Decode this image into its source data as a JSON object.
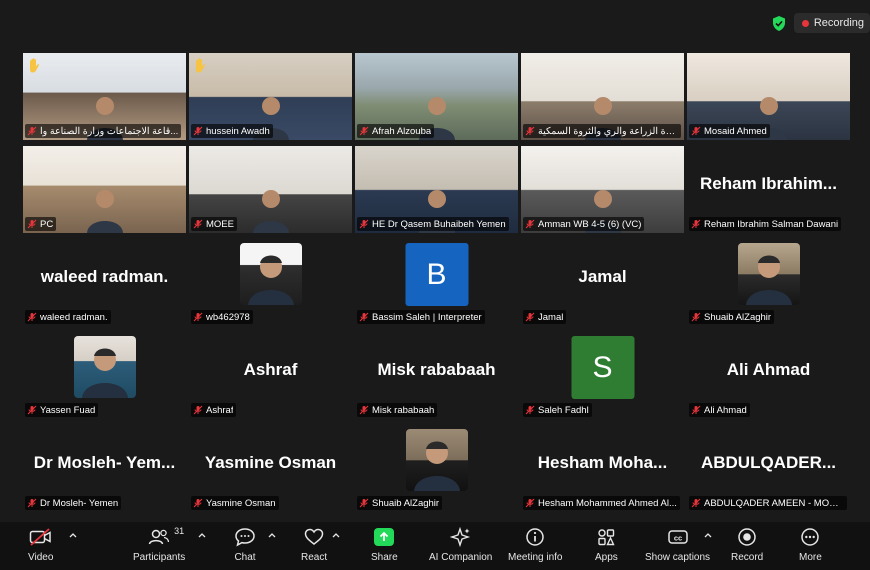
{
  "status": {
    "recording_label": "Recording",
    "secure_icon": "shield-check-icon",
    "recording_color": "#e8353b"
  },
  "colors": {
    "active_speaker": "#23d959",
    "share_button": "#23d959"
  },
  "tiles": [
    {
      "name": "قاعة الاجتماعات وزارة الصناعة وا...",
      "type": "video",
      "hand": true
    },
    {
      "name": "hussein Awadh",
      "type": "video",
      "hand": true
    },
    {
      "name": "Afrah Alzouba",
      "type": "video",
      "hand": false
    },
    {
      "name": "وزارة الزراعة والري والثروة السمكية",
      "type": "video",
      "hand": false
    },
    {
      "name": "Mosaid Ahmed",
      "type": "video",
      "hand": false
    },
    {
      "name": "PC",
      "type": "video",
      "hand": false
    },
    {
      "name": "MOEE",
      "type": "video",
      "hand": false,
      "active": true
    },
    {
      "name": "HE Dr Qasem Buhaibeh Yemen",
      "type": "video",
      "hand": false
    },
    {
      "name": "Amman WB 4-5 (6) (VC)",
      "type": "video",
      "hand": false
    },
    {
      "name": "Reham Ibrahim Salman Dawani",
      "type": "text",
      "display": "Reham Ibrahim..."
    },
    {
      "name": "waleed radman.",
      "type": "text",
      "display": "waleed radman."
    },
    {
      "name": "wb462978",
      "type": "photo"
    },
    {
      "name": "Bassim Saleh | Interpreter",
      "type": "letter",
      "letter": "B",
      "color": "#1565c0"
    },
    {
      "name": "Jamal",
      "type": "text",
      "display": "Jamal"
    },
    {
      "name": "Shuaib AlZaghir",
      "type": "photo"
    },
    {
      "name": "Yassen Fuad",
      "type": "photo"
    },
    {
      "name": "Ashraf",
      "type": "text",
      "display": "Ashraf"
    },
    {
      "name": "Misk rababaah",
      "type": "text",
      "display": "Misk rababaah"
    },
    {
      "name": "Saleh Fadhl",
      "type": "letter",
      "letter": "S",
      "color": "#2e7d32"
    },
    {
      "name": "Ali Ahmad",
      "type": "text",
      "display": "Ali Ahmad"
    },
    {
      "name": "Dr Mosleh- Yemen",
      "type": "text",
      "display": "Dr Mosleh- Yem..."
    },
    {
      "name": "Yasmine Osman",
      "type": "text",
      "display": "Yasmine Osman"
    },
    {
      "name": "Shuaib AlZaghir",
      "type": "photo"
    },
    {
      "name": "Hesham Mohammed Ahmed Al...",
      "type": "text",
      "display": "Hesham Moha..."
    },
    {
      "name": "ABDULQADER AMEEN - MOF-Y...",
      "type": "text",
      "display": "ABDULQADER..."
    }
  ],
  "toolbar": {
    "video": "Video",
    "participants": "Participants",
    "participants_count": "31",
    "chat": "Chat",
    "react": "React",
    "share": "Share",
    "ai_companion": "AI Companion",
    "meeting_info": "Meeting info",
    "apps": "Apps",
    "show_captions": "Show captions",
    "record": "Record",
    "more": "More"
  }
}
